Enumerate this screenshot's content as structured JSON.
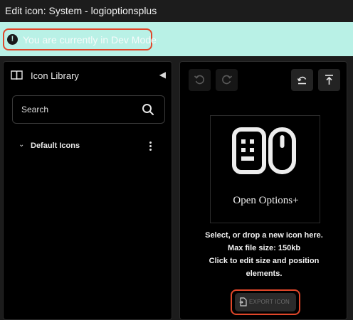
{
  "window": {
    "title": "Edit icon: System - logioptionsplus"
  },
  "banner": {
    "icon": "!",
    "text": "You are currently in Dev Mode",
    "background": "#b9f1e6",
    "highlight_color": "#e0472a"
  },
  "library": {
    "title": "Icon Library",
    "search": {
      "placeholder": "Search",
      "value": ""
    },
    "groups": [
      {
        "label": "Default Icons",
        "expanded": true
      }
    ]
  },
  "editor": {
    "toolbar": {
      "undo": "undo-icon",
      "redo": "redo-icon",
      "reset": "reset-icon",
      "upload": "upload-icon"
    },
    "preview": {
      "label": "Open Options+"
    },
    "drop_hint": {
      "line1": "Select, or drop a new icon here.",
      "line2": "Max file size: 150kb",
      "line3": "Click to edit size and position",
      "line4": "elements."
    },
    "export": {
      "label": "EXPORT ICON"
    }
  }
}
